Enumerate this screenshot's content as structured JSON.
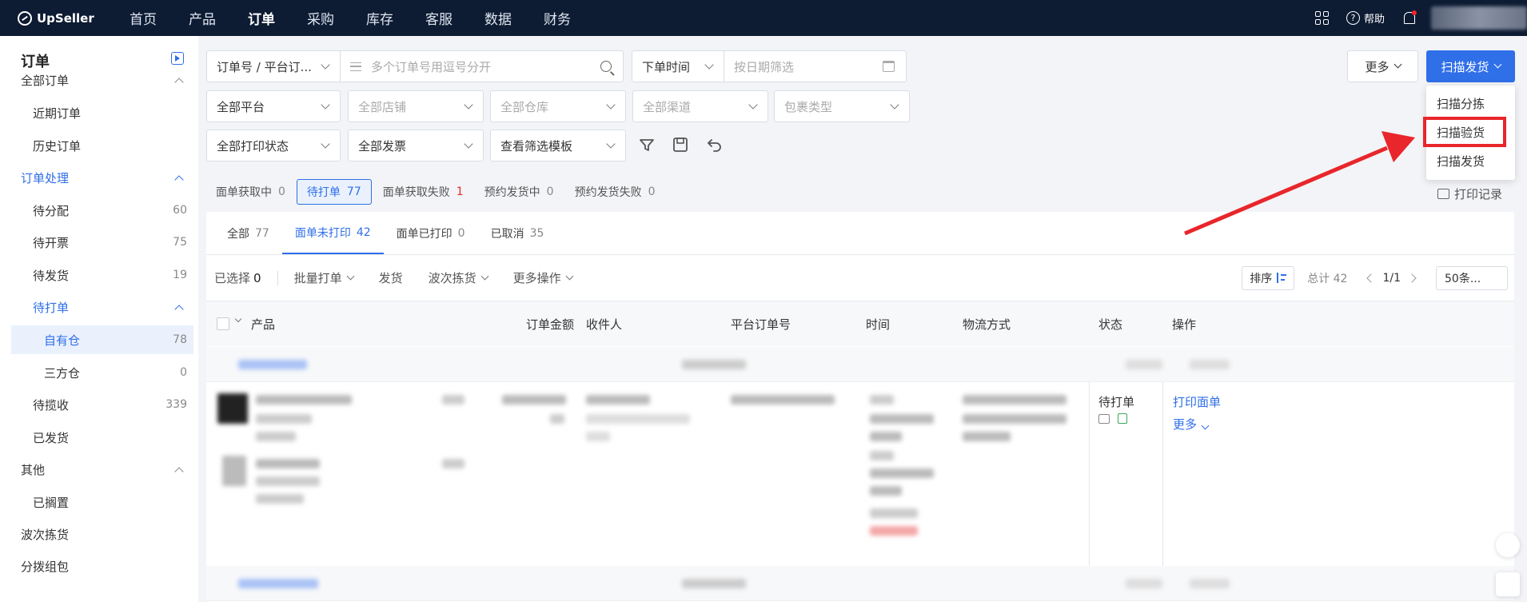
{
  "brand": {
    "name": "UpSeller"
  },
  "topnav": {
    "items": [
      "首页",
      "产品",
      "订单",
      "采购",
      "库存",
      "客服",
      "数据",
      "财务"
    ],
    "active": "订单",
    "help_label": "帮助"
  },
  "sidebar": {
    "title": "订单",
    "items": [
      {
        "label": "全部订单",
        "count": "",
        "level": 0,
        "chevron": true
      },
      {
        "label": "近期订单",
        "count": "",
        "level": 1
      },
      {
        "label": "历史订单",
        "count": "",
        "level": 1
      },
      {
        "label": "订单处理",
        "count": "",
        "level": 0,
        "chevron": true,
        "blue": true
      },
      {
        "label": "待分配",
        "count": "60",
        "level": 1
      },
      {
        "label": "待开票",
        "count": "75",
        "level": 1
      },
      {
        "label": "待发货",
        "count": "19",
        "level": 1
      },
      {
        "label": "待打单",
        "count": "",
        "level": 1,
        "chevron": true,
        "blue": true
      },
      {
        "label": "自有仓",
        "count": "78",
        "level": 2,
        "selected": true
      },
      {
        "label": "三方仓",
        "count": "0",
        "level": 2
      },
      {
        "label": "待揽收",
        "count": "339",
        "level": 1
      },
      {
        "label": "已发货",
        "count": "",
        "level": 1
      },
      {
        "label": "其他",
        "count": "",
        "level": 0,
        "chevron": true
      },
      {
        "label": "已搁置",
        "count": "",
        "level": 1
      },
      {
        "label": "波次拣货",
        "count": "",
        "level": 0
      },
      {
        "label": "分拨组包",
        "count": "",
        "level": 0
      }
    ]
  },
  "filters": {
    "order_type": "订单号 / 平台订...",
    "search_placeholder": "多个订单号用逗号分开",
    "time_type": "下单时间",
    "date_placeholder": "按日期筛选",
    "platform": "全部平台",
    "store": "全部店铺",
    "warehouse": "全部仓库",
    "channel": "全部渠道",
    "package": "包裹类型",
    "print_status": "全部打印状态",
    "invoice": "全部发票",
    "template": "查看筛选模板"
  },
  "actions": {
    "more": "更多",
    "scan_ship": "扫描发货",
    "menu": [
      "扫描分拣",
      "扫描验货",
      "扫描发货"
    ],
    "print_log": "打印记录"
  },
  "status_tabs": [
    {
      "label": "面单获取中",
      "count": "0"
    },
    {
      "label": "待打单",
      "count": "77",
      "active": true
    },
    {
      "label": "面单获取失败",
      "count": "1",
      "red": true
    },
    {
      "label": "预约发货中",
      "count": "0"
    },
    {
      "label": "预约发货失败",
      "count": "0"
    }
  ],
  "panel_tabs": [
    {
      "label": "全部",
      "count": "77"
    },
    {
      "label": "面单未打印",
      "count": "42",
      "active": true
    },
    {
      "label": "面单已打印",
      "count": "0"
    },
    {
      "label": "已取消",
      "count": "35"
    }
  ],
  "toolbar": {
    "selected_label": "已选择",
    "selected_count": "0",
    "batch_print": "批量打单",
    "ship": "发货",
    "wave": "波次拣货",
    "more_ops": "更多操作",
    "sort": "排序",
    "total": "总计 42",
    "page": "1/1",
    "per_page": "50条..."
  },
  "table": {
    "columns": [
      "产品",
      "订单金额",
      "收件人",
      "平台订单号",
      "时间",
      "物流方式",
      "状态",
      "操作"
    ]
  },
  "order": {
    "status": "待打单",
    "print_label": "打印面单",
    "more_label": "更多"
  },
  "colors": {
    "primary": "#2f6fe8",
    "nav_bg": "#0d1b33",
    "highlight": "#e8262b"
  }
}
